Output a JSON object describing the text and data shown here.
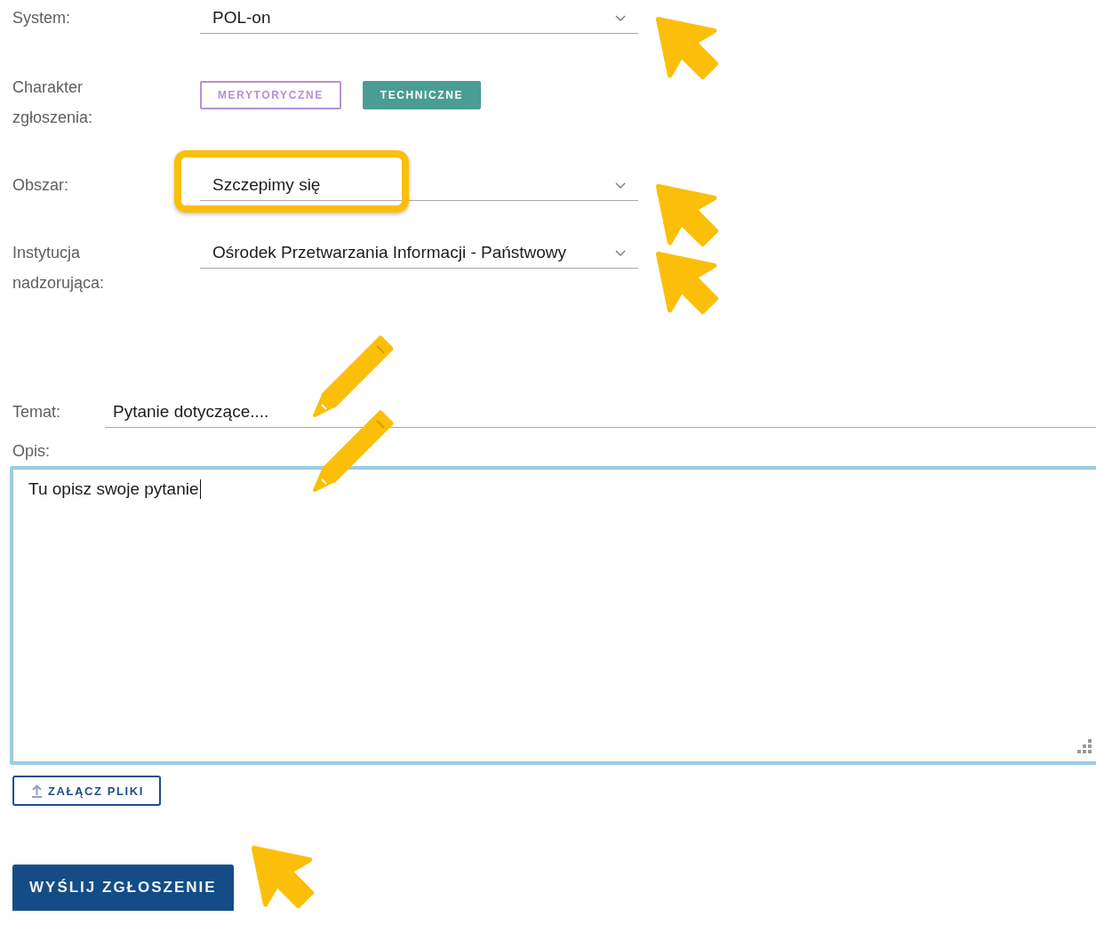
{
  "form": {
    "fields": [
      {
        "kind": "select",
        "label": "System:",
        "value": "POL-on",
        "markers": [
          {
            "kind": "arrow"
          }
        ]
      },
      {
        "kind": "chips",
        "label": "Charakter zgłoszenia:",
        "options": [
          {
            "label": "MERYTORYCZNE",
            "selected": false,
            "color": "#b690d6"
          },
          {
            "label": "TECHNICZNE",
            "selected": true,
            "color": "#4a9d94"
          }
        ]
      },
      {
        "kind": "select",
        "label": "Obszar:",
        "value": "Szczepimy się",
        "markers": [
          {
            "kind": "highlight"
          },
          {
            "kind": "arrow"
          }
        ]
      },
      {
        "kind": "select",
        "label": "Instytucja nadzorująca:",
        "value": "Ośrodek Przetwarzania Informacji - Państwowy",
        "markers": [
          {
            "kind": "arrow"
          }
        ]
      },
      {
        "kind": "text",
        "label": "Temat:",
        "value": "Pytanie dotyczące....",
        "markers": [
          {
            "kind": "pencil"
          }
        ]
      }
    ],
    "description": {
      "label": "Opis:",
      "value": "Tu opisz swoje pytanie",
      "focused": true,
      "markers": [
        {
          "kind": "pencil"
        }
      ]
    },
    "attach_button": {
      "label": "ZAŁĄCZ PLIKI"
    },
    "submit_button": {
      "label": "WYŚLIJ ZGŁOSZENIE",
      "markers": [
        {
          "kind": "arrow"
        }
      ]
    }
  }
}
